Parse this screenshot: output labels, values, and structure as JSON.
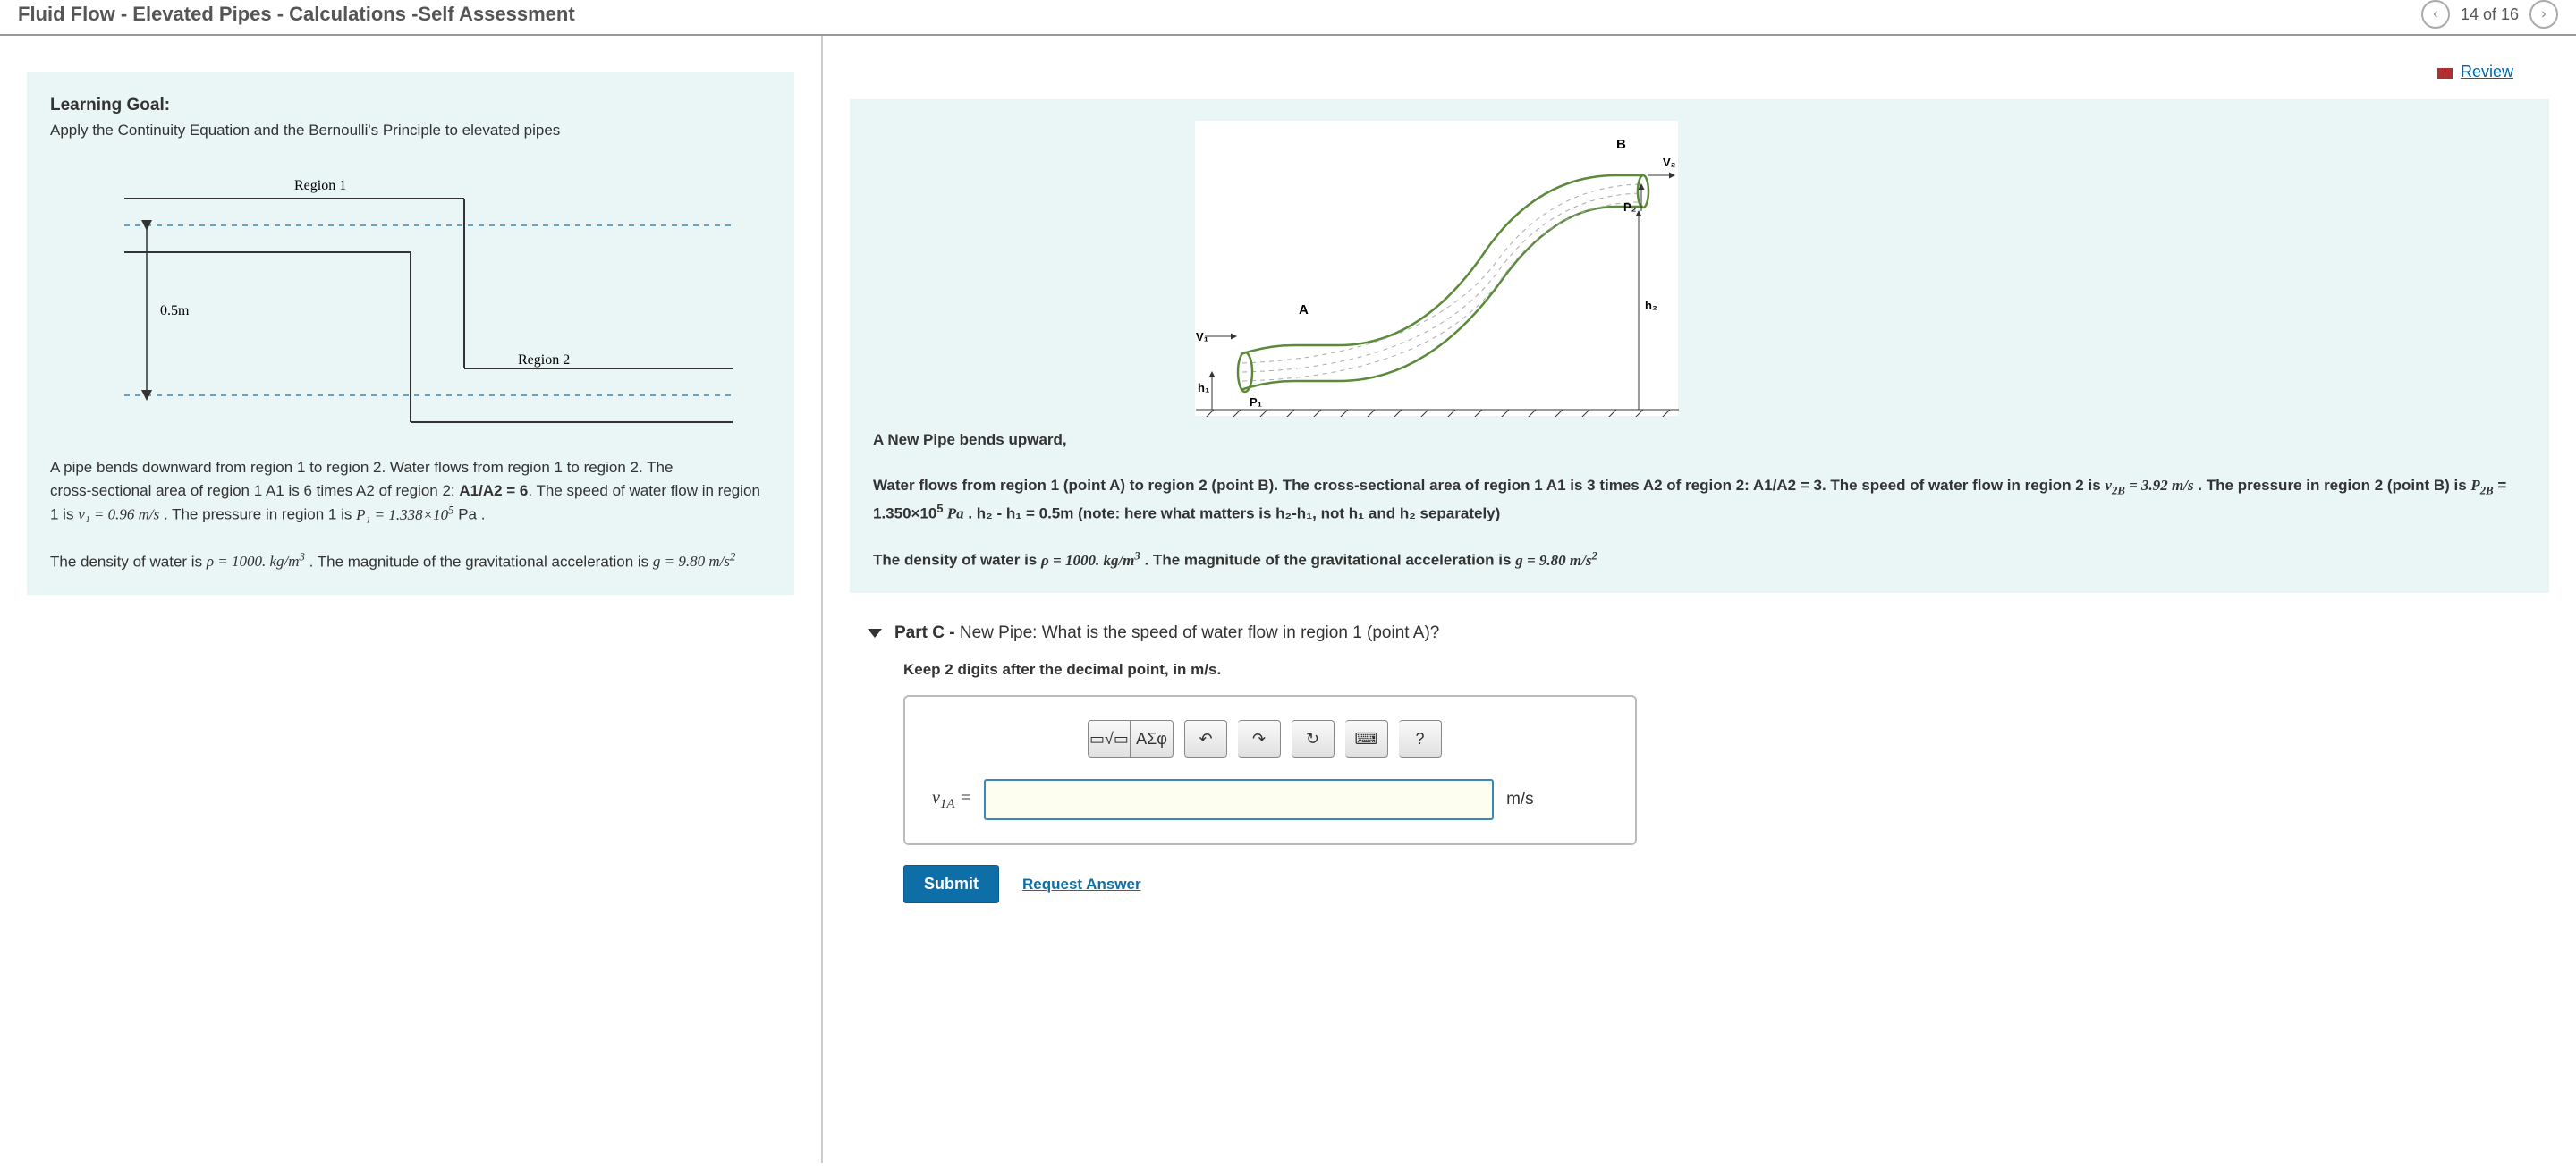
{
  "header": {
    "title": "Fluid Flow - Elevated Pipes - Calculations -Self Assessment",
    "progress": "14 of 16"
  },
  "review": {
    "label": "Review"
  },
  "left": {
    "lg_title": "Learning Goal:",
    "lg_text": "Apply the Continuity Equation and the Bernoulli's Principle to elevated pipes",
    "region1": "Region 1",
    "region2": "Region 2",
    "height": "0.5m",
    "p1_a": "A pipe bends downward from region 1 to region 2. Water flows from region 1 to region 2. The cross‑sectional area of region 1 A1 is 6 times A2 of region 2: ",
    "p1_b": "A1/A2 = 6",
    "p1_c": ". The speed of water flow in region 1 is ",
    "p1_d": "v₁ = 0.96 m/s",
    "p1_e": " . The pressure in region 1 is ",
    "p1_f": "P₁ = 1.338×10",
    "p1_g": " Pa .",
    "p2_a": "The density of water is ",
    "p2_b": "ρ = 1000. kg/m",
    "p2_c": " . The magnitude of the gravitational acceleration is ",
    "p2_d": "g = 9.80 m/s"
  },
  "right_intro": {
    "line1": "A New Pipe bends upward,",
    "line2a": "Water flows from region 1 (point A) to region 2 (point B). The cross‑sectional area of region 1 A1 is 3 times A2 of region 2: A1/A2 = 3. The speed of water flow in region 2 is ",
    "v2b": "v",
    "v2b_sub": "2B",
    "eq1": " = 3.92 m/s",
    "line2b": " . The pressure in region 2 (point B)  is ",
    "p2b": "P",
    "p2b_sub": "2B",
    "eq2": " = 1.350×10",
    "eq2_sup": "5",
    "eq2_unit": " Pa",
    "line2c": " . h₂ - h₁ = 0.5m  (note: here what matters is h₂-h₁, not h₁ and h₂ separately)",
    "line3a": "The density of water is ",
    "rho": "ρ = 1000. kg/m",
    "rho_sup": "3",
    "line3b": " . The magnitude of the gravitational acceleration is ",
    "g": "g = 9.80 m/s",
    "g_sup": "2",
    "fig": {
      "A": "A",
      "B": "B",
      "V1": "V₁",
      "V2": "V₂",
      "P1": "P₁",
      "P2": "P₂",
      "h1": "h₁",
      "h2": "h₂"
    }
  },
  "part": {
    "label_bold": "Part C - ",
    "label_rest": "New Pipe: What is the speed of water flow in region 1 (point A)?",
    "hint": "Keep 2 digits after the decimal point, in m/s.",
    "toolbar": {
      "templates": "▭√▭",
      "symbols": "ΑΣφ",
      "undo": "↶",
      "redo": "↷",
      "reset": "↻",
      "keyboard": "⌨",
      "help": "?"
    },
    "var_prefix": "v",
    "var_sub": "1A",
    "equals": " =",
    "unit": "m/s",
    "submit": "Submit",
    "request": "Request Answer"
  }
}
